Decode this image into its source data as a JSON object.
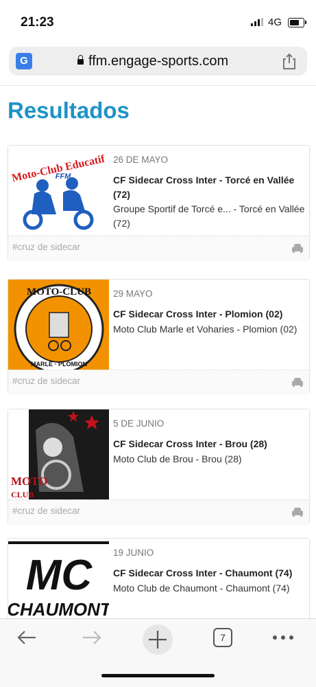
{
  "status": {
    "time": "21:23",
    "network": "4G"
  },
  "browser": {
    "url": "ffm.engage-sports.com",
    "tab_count": "7",
    "translate_icon": "google-translate-icon"
  },
  "page": {
    "title": "Resultados"
  },
  "events": [
    {
      "date": "26 DE MAYO",
      "title": "CF Sidecar Cross Inter - Torcé en Vallée (72)",
      "subtitle": "Groupe Sportif de Torcé e... - Torcé en Vallée (72)",
      "tag": "#cruz de sidecar",
      "logo_text": "Moto-Club Educatif",
      "logo_sub": "FFM"
    },
    {
      "date": "29 MAYO",
      "title": "CF Sidecar Cross Inter - Plomion (02)",
      "subtitle": "Moto Club Marle et Voharies - Plomion (02)",
      "tag": "#cruz de sidecar",
      "logo_text": "MOTO-CLUB",
      "logo_sub": "MARLE · PLOMION"
    },
    {
      "date": "5 DE JUNIO",
      "title": "CF Sidecar Cross Inter - Brou (28)",
      "subtitle": "Moto Club de Brou - Brou (28)",
      "tag": "#cruz de sidecar",
      "logo_text": "MOTO",
      "logo_sub": "CLUB"
    },
    {
      "date": "19 JUNIO",
      "title": "CF Sidecar Cross Inter - Chaumont (74)",
      "subtitle": "Moto Club de Chaumont - Chaumont (74)",
      "tag": "",
      "logo_text": "MC",
      "logo_sub": "CHAUMONT"
    }
  ],
  "colors": {
    "accent": "#1e93c7",
    "orange_logo": "#f39200",
    "red_logo": "#d7191c"
  }
}
